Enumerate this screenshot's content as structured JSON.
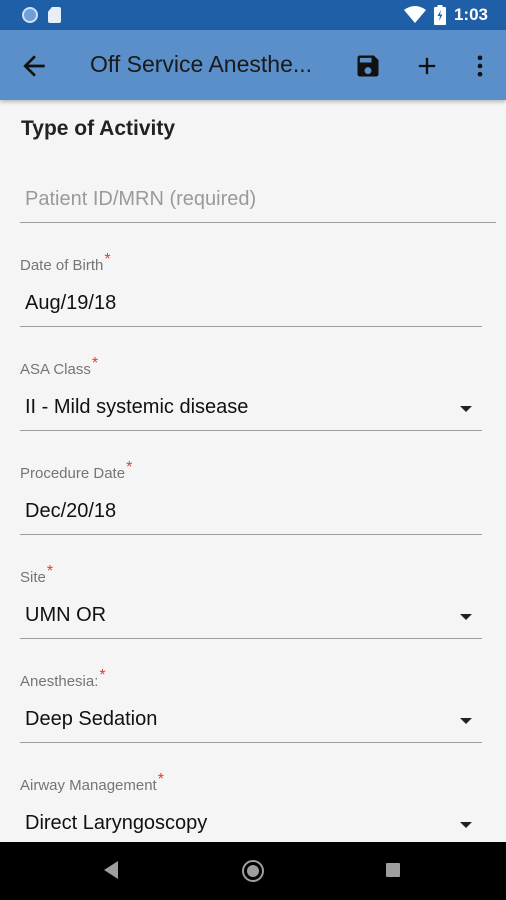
{
  "status_bar": {
    "time": "1:03",
    "icons": [
      "circle-notification-icon",
      "sd-card-icon",
      "wifi-icon",
      "battery-icon"
    ]
  },
  "app_bar": {
    "title": "Off Service Anesthe...",
    "icons": [
      "back-arrow-icon",
      "save-icon",
      "add-icon",
      "more-vert-icon"
    ]
  },
  "form": {
    "section_title": "Type of Activity",
    "patient_id": {
      "placeholder": "Patient ID/MRN (required)",
      "value": ""
    },
    "dob": {
      "label": "Date of Birth",
      "required_mark": "*",
      "value": "Aug/19/18"
    },
    "asa_class": {
      "label": "ASA Class",
      "required_mark": "*",
      "value": "II - Mild systemic disease"
    },
    "procedure_date": {
      "label": "Procedure Date",
      "required_mark": "*",
      "value": "Dec/20/18"
    },
    "site": {
      "label": "Site",
      "required_mark": "*",
      "value": "UMN OR"
    },
    "anesthesia": {
      "label": "Anesthesia:",
      "required_mark": "*",
      "value": "Deep Sedation"
    },
    "airway": {
      "label": "Airway Management",
      "required_mark": "*",
      "value": "Direct Laryngoscopy"
    }
  },
  "colors": {
    "status_bar": "#1f5fa8",
    "app_bar": "#5b8fc9",
    "background": "#f5f5f5",
    "required": "#e53935"
  }
}
